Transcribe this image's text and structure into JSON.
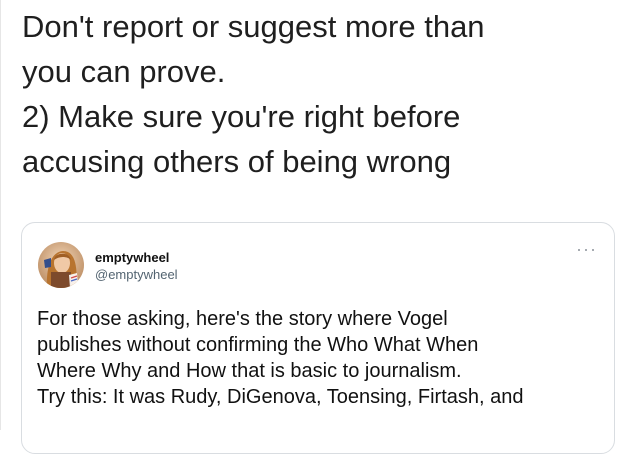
{
  "tweet": {
    "text_lines": [
      "Don't report or suggest more than",
      "you can prove.",
      "2) Make sure you're right before",
      "accusing others of being wrong"
    ]
  },
  "quote": {
    "author_name": "emptywheel",
    "author_handle": "@emptywheel",
    "avatar_icon": "avatar-photo",
    "menu_icon": "more-horizontal-icon",
    "paragraph1_lines": [
      "For those asking, here's the story where Vogel",
      "publishes without confirming the Who What When",
      "Where Why and How that is basic to journalism."
    ],
    "paragraph2_lines": [
      "Try this: It was Rudy, DiGenova, Toensing, Firtash, and"
    ]
  },
  "colors": {
    "text": "#1f1f1f",
    "handle": "#536471",
    "card_border": "#d9dde1"
  }
}
